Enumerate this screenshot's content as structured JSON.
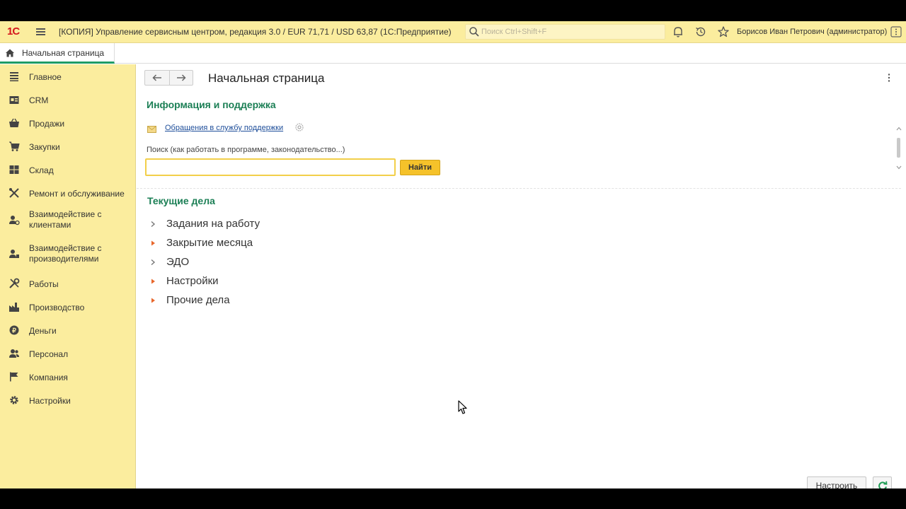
{
  "titlebar": {
    "logo": "1С",
    "app_title": "[КОПИЯ] Управление сервисным центром, редакция 3.0 / EUR 71,71 / USD 63,87  (1С:Предприятие)",
    "search_placeholder": "Поиск Ctrl+Shift+F",
    "user": "Борисов Иван Петрович (администратор)"
  },
  "tabs": [
    {
      "label": "Начальная страница",
      "icon": "home-icon",
      "active": true
    }
  ],
  "sidebar": {
    "items": [
      {
        "label": "Главное",
        "icon": "menu-lines-icon"
      },
      {
        "label": "CRM",
        "icon": "crm-icon"
      },
      {
        "label": "Продажи",
        "icon": "basket-icon"
      },
      {
        "label": "Закупки",
        "icon": "cart-icon"
      },
      {
        "label": "Склад",
        "icon": "warehouse-icon"
      },
      {
        "label": "Ремонт и обслуживание",
        "icon": "tools-icon"
      },
      {
        "label": "Взаимодействие с\nклиентами",
        "icon": "client-icon"
      },
      {
        "label": "Взаимодействие с\nпроизводителями",
        "icon": "producer-icon"
      },
      {
        "label": "Работы",
        "icon": "works-icon"
      },
      {
        "label": "Производство",
        "icon": "factory-icon"
      },
      {
        "label": "Деньги",
        "icon": "money-icon"
      },
      {
        "label": "Персонал",
        "icon": "staff-icon"
      },
      {
        "label": "Компания",
        "icon": "flag-icon"
      },
      {
        "label": "Настройки",
        "icon": "gear-icon"
      }
    ]
  },
  "main": {
    "page_title": "Начальная страница",
    "info_section": {
      "title": "Информация и поддержка",
      "support_link": "Обращения в службу поддержки",
      "search_label": "Поиск (как работать в программе, законодательство...)",
      "search_value": "",
      "find_button": "Найти"
    },
    "tasks_section": {
      "title": "Текущие дела",
      "items": [
        {
          "label": "Задания на работу",
          "marker": "gray"
        },
        {
          "label": "Закрытие месяца",
          "marker": "orange"
        },
        {
          "label": "ЭДО",
          "marker": "gray"
        },
        {
          "label": "Настройки",
          "marker": "orange"
        },
        {
          "label": "Прочие дела",
          "marker": "orange"
        }
      ]
    },
    "buttons": {
      "configure": "Настроить"
    }
  },
  "colors": {
    "sidebar_bg": "#fbed9e",
    "section_title": "#1b7f55",
    "accent_button": "#f5c22a",
    "task_marker_orange": "#e8672c",
    "task_marker_gray": "#777777"
  }
}
